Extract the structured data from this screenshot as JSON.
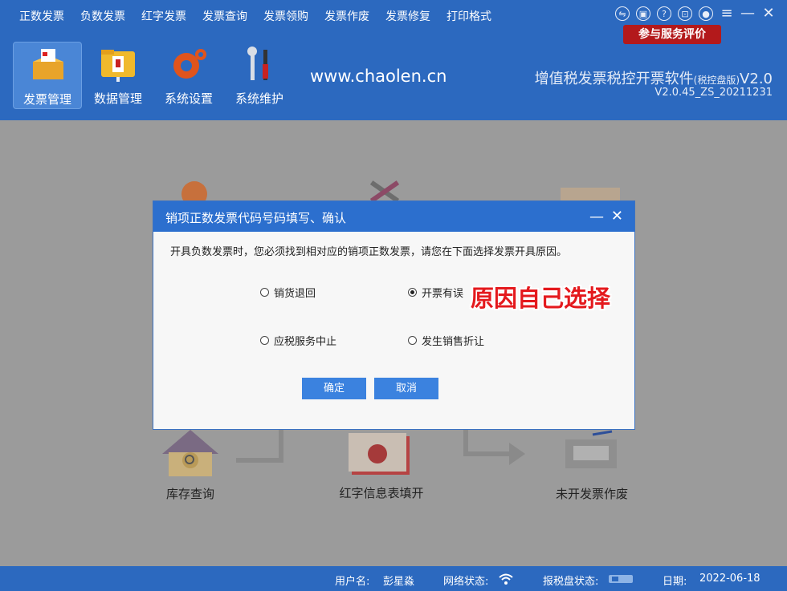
{
  "menu": [
    "正数发票",
    "负数发票",
    "红字发票",
    "发票查询",
    "发票领购",
    "发票作废",
    "发票修复",
    "打印格式"
  ],
  "service_button": "参与服务评价",
  "toolbar": [
    {
      "label": "发票管理",
      "icon": "invoice-box-icon",
      "active": true
    },
    {
      "label": "数据管理",
      "icon": "folder-icon",
      "active": false
    },
    {
      "label": "系统设置",
      "icon": "gear-icon",
      "active": false
    },
    {
      "label": "系统维护",
      "icon": "tools-icon",
      "active": false
    }
  ],
  "header": {
    "site": "www.chaolen.cn",
    "product": "增值税发票税控开票软件",
    "product_edition": "(税控盘版)",
    "product_version": "V2.0",
    "build": "V2.0.45_ZS_20211231"
  },
  "background_labels": {
    "inventory": "库存查询",
    "red_info": "红字信息表填开",
    "void_unissued": "未开发票作废"
  },
  "dialog": {
    "title": "销项正数发票代码号码填写、确认",
    "message": "开具负数发票时，您必须找到相对应的销项正数发票，请您在下面选择发票开具原因。",
    "options": [
      {
        "label": "销货退回",
        "checked": false
      },
      {
        "label": "开票有误",
        "checked": true
      },
      {
        "label": "应税服务中止",
        "checked": false
      },
      {
        "label": "发生销售折让",
        "checked": false
      }
    ],
    "annotation": "原因自己选择",
    "ok": "确定",
    "cancel": "取消"
  },
  "status": {
    "user_label": "用户名:",
    "user": "彭星淼",
    "network_label": "网络状态:",
    "disk_label": "报税盘状态:",
    "date_label": "日期:",
    "date": "2022-06-18"
  },
  "colors": {
    "header": "#2c69bf",
    "dialog_header": "#2c6fce",
    "button": "#3b82df",
    "annotation": "#e4191d",
    "service": "#b3191b"
  }
}
